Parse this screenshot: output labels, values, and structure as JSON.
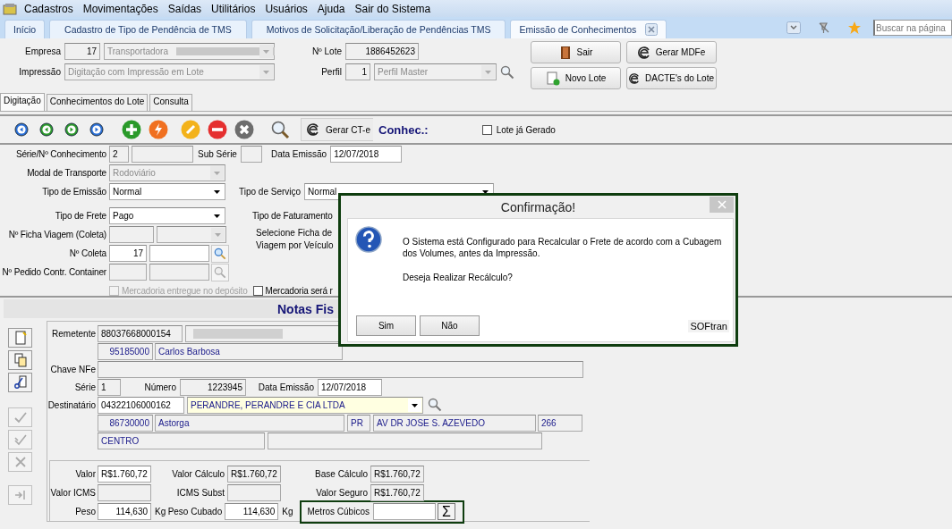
{
  "menu": [
    {
      "label": "Cadastros"
    },
    {
      "label": "Movimentações"
    },
    {
      "label": "Saídas"
    },
    {
      "label": "Utilitários"
    },
    {
      "label": "Usuários"
    },
    {
      "label": "Ajuda"
    },
    {
      "label": "Sair do Sistema"
    }
  ],
  "tabs": [
    {
      "label": "Início",
      "selected": false
    },
    {
      "label": "Cadastro de Tipo de Pendência de TMS",
      "selected": false
    },
    {
      "label": "Motivos de Solicitação/Liberação de Pendências TMS",
      "selected": false
    },
    {
      "label": "Emissão de Conhecimentos",
      "selected": true
    }
  ],
  "search": {
    "placeholder": "Buscar na página"
  },
  "header": {
    "empresa_label": "Empresa",
    "empresa_code": "17",
    "empresa_name": "Transportadora",
    "empresa_redacted": true,
    "impressao_label": "Impressão",
    "impressao": "Digitação com Impressão em Lote",
    "lote_label": "Nº Lote",
    "lote": "1886452623",
    "perfil_label": "Perfil",
    "perfil_code": "1",
    "perfil": "Perfil Master"
  },
  "actions": [
    {
      "label": "Sair",
      "kind": "exit"
    },
    {
      "label": "Gerar MDFe",
      "kind": "e"
    },
    {
      "label": "Novo Lote",
      "kind": "new"
    },
    {
      "label": "DACTE's do Lote",
      "kind": "e"
    }
  ],
  "subtabs": [
    {
      "label": "Digitação",
      "selected": true
    },
    {
      "label": "Conhecimentos do Lote",
      "selected": false
    },
    {
      "label": "Consulta",
      "selected": false
    }
  ],
  "toolbar": {
    "tools": [
      {
        "kind": "first"
      },
      {
        "kind": "prev"
      },
      {
        "kind": "next"
      },
      {
        "kind": "last"
      },
      {
        "kind": "add"
      },
      {
        "kind": "execute"
      },
      {
        "kind": "edit"
      },
      {
        "kind": "remove"
      },
      {
        "kind": "cancel"
      },
      {
        "kind": "search"
      }
    ],
    "gerar": "Gerar CT-e",
    "conhec": "Conhec.:",
    "lote_gerado": {
      "label": "Lote já Gerado",
      "checked": false
    }
  },
  "form": {
    "serie_label": "Série/Nº Conhecimento",
    "serie": "2",
    "sub_serie_label": "Sub Série",
    "data_label": "Data Emissão",
    "data": "12/07/2018",
    "modal_label": "Modal de Transporte",
    "modal": {
      "value": "Rodoviário",
      "disabled": true
    },
    "emissao_label": "Tipo de Emissão",
    "emissao": "Normal",
    "servico_label": "Tipo de Serviço",
    "servico": "Normal",
    "frete_label": "Tipo de Frete",
    "frete": "Pago",
    "faturamento_label": "Tipo de Faturamento",
    "ficha_label": "Nº Ficha Viagem (Coleta)",
    "selecione_label": "Selecione Ficha de Viagem por Veículo",
    "coleta_label": "Nº Coleta",
    "coleta": "17",
    "pedido_label": "Nº Pedido Contr. Container",
    "checks": [
      {
        "label": "Mercadoria entregue no depósito",
        "checked": false,
        "disabled": true
      },
      {
        "label": "Mercadoria será r",
        "checked": false,
        "disabled": false
      }
    ]
  },
  "notas": {
    "title": "Notas Fis",
    "tools": [
      {
        "kind": "new",
        "disabled": false
      },
      {
        "kind": "copy",
        "disabled": false
      },
      {
        "kind": "cut",
        "disabled": false
      },
      {
        "kind": "check",
        "disabled": true
      },
      {
        "kind": "check-all",
        "disabled": true
      },
      {
        "kind": "delete",
        "disabled": true
      },
      {
        "kind": "insert",
        "disabled": true
      }
    ],
    "remetente_label": "Remetente",
    "remetente_doc": "88037668000154",
    "remetente_redacted": true,
    "remetente_cep": "95185000",
    "remetente_cidade": "Carlos Barbosa",
    "chave_label": "Chave NFe",
    "serie_label": "Série",
    "serie": "1",
    "numero_label": "Número",
    "numero": "1223945",
    "data_label": "Data Emissão",
    "data": "12/07/2018",
    "dest_label": "Destinatário",
    "dest_doc": "04322106000162",
    "dest_nome": "PERANDRE, PERANDRE E CIA LTDA",
    "dest_cep": "86730000",
    "dest_cidade": "Astorga",
    "dest_uf": "PR",
    "dest_endereco": "AV DR JOSE S. AZEVEDO",
    "dest_numero": "266",
    "dest_bairro": "CENTRO",
    "valores": {
      "valor_label": "Valor",
      "valor": "R$1.760,72",
      "calc_label": "Valor Cálculo",
      "calc": "R$1.760,72",
      "base_label": "Base Cálculo",
      "base": "R$1.760,72",
      "icms_label": "Valor ICMS",
      "subst_label": "ICMS Subst",
      "seguro_label": "Valor Seguro",
      "seguro": "R$1.760,72",
      "peso_label": "Peso",
      "peso": "114,630",
      "peso_unit": "Kg",
      "cubado_label": "Peso Cubado",
      "cubado": "114,630",
      "cubado_unit": "Kg",
      "metros_label": "Metros Cúbicos",
      "sigma": "Σ"
    }
  },
  "dialog": {
    "title": "Confirmação!",
    "message": "O Sistema está Configurado para Recalcular o Frete de acordo com a Cubagem dos Volumes, antes da Impressão.",
    "question": "Deseja Realizar Recálculo?",
    "buttons": [
      {
        "label": "Sim"
      },
      {
        "label": "Não"
      }
    ],
    "brand": "SOFtran"
  }
}
